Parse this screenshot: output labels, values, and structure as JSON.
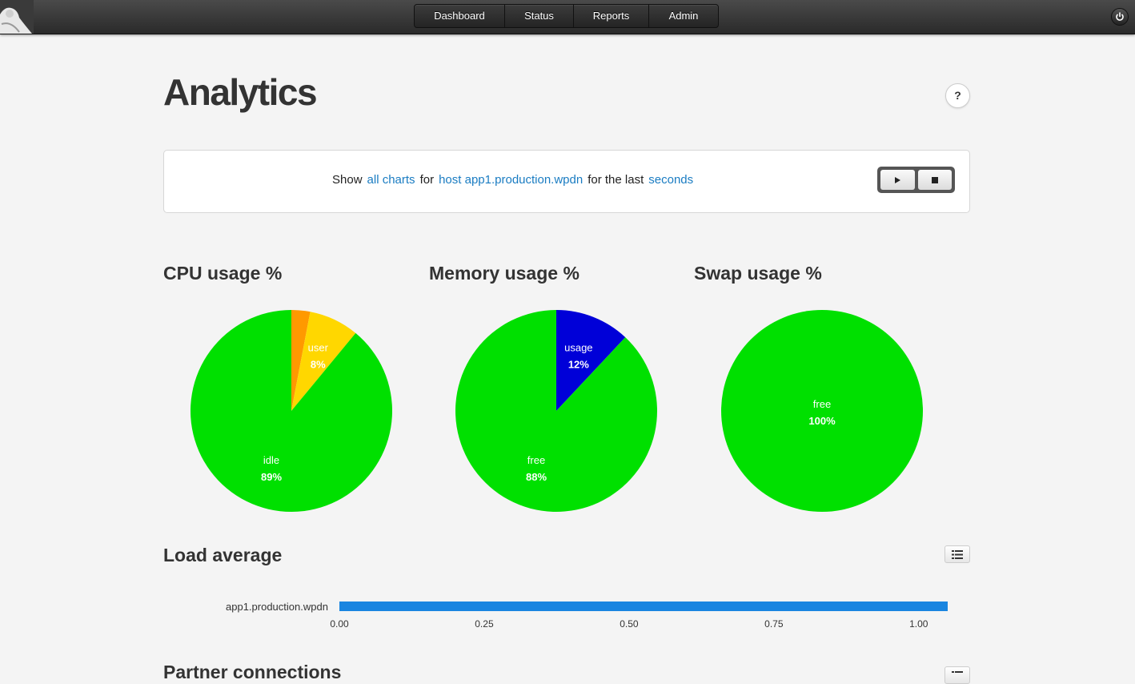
{
  "nav": {
    "items": [
      {
        "label": "Dashboard"
      },
      {
        "label": "Status"
      },
      {
        "label": "Reports"
      },
      {
        "label": "Admin"
      }
    ]
  },
  "page": {
    "title": "Analytics",
    "help_label": "?"
  },
  "filter": {
    "show": "Show",
    "charts_link": "all charts",
    "for": "for",
    "host_link": "host app1.production.wpdn",
    "for_last": "for the last",
    "period_link": "seconds"
  },
  "chart_data": [
    {
      "type": "pie",
      "title": "CPU usage %",
      "slices": [
        {
          "label": "idle",
          "value": 89,
          "color": "#00e000",
          "display": "89%",
          "show_label": true
        },
        {
          "label": "user",
          "value": 8,
          "color": "#ffd700",
          "display": "8%",
          "show_label": true
        },
        {
          "label": "",
          "value": 3,
          "color": "#ff9900",
          "display": "",
          "show_label": false
        }
      ]
    },
    {
      "type": "pie",
      "title": "Memory usage %",
      "slices": [
        {
          "label": "free",
          "value": 88,
          "color": "#00e000",
          "display": "88%",
          "show_label": true
        },
        {
          "label": "usage",
          "value": 12,
          "color": "#0000d8",
          "display": "12%",
          "show_label": true
        }
      ]
    },
    {
      "type": "pie",
      "title": "Swap usage %",
      "slices": [
        {
          "label": "free",
          "value": 100,
          "color": "#00e000",
          "display": "100%",
          "show_label": true
        }
      ]
    },
    {
      "type": "bar",
      "title": "Load average",
      "orientation": "horizontal",
      "categories": [
        "app1.production.wpdn"
      ],
      "values": [
        1.05
      ],
      "xlim": [
        0,
        1.05
      ],
      "ticks": [
        "0.00",
        "0.25",
        "0.50",
        "0.75",
        "1.00"
      ],
      "color": "#1a85e0"
    }
  ],
  "next_section": {
    "title": "Partner connections"
  },
  "colors": {
    "link": "#1a7cc2",
    "topbar": "#333333"
  },
  "icons": {
    "power": "power-icon",
    "help": "help-icon",
    "play": "play-icon",
    "stop": "stop-icon",
    "list": "list-icon"
  }
}
